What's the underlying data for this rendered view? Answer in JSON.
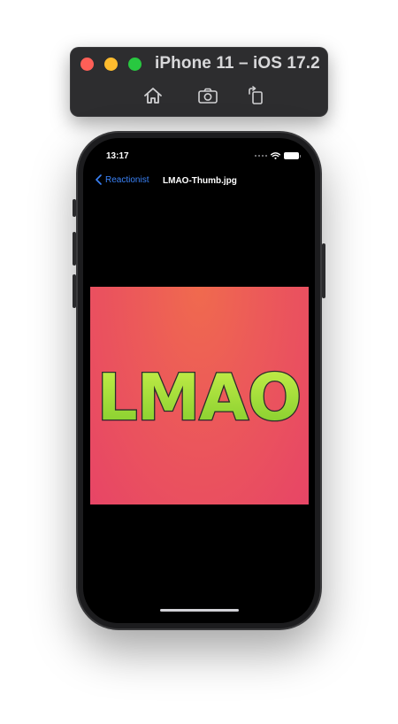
{
  "simulator": {
    "title": "iPhone 11 – iOS 17.2",
    "toolbar": [
      {
        "icon": "home-icon"
      },
      {
        "icon": "screenshot-icon"
      },
      {
        "icon": "rotate-icon"
      }
    ]
  },
  "status_bar": {
    "time": "13:17",
    "icons": [
      "signal-dots-icon",
      "wifi-icon",
      "battery-icon"
    ]
  },
  "nav": {
    "back_label": "Reactionist",
    "title": "LMAO-Thumb.jpg",
    "accent_color": "#3a82f7"
  },
  "image": {
    "text": "LMAO",
    "background_colors": [
      "#f06a4e",
      "#e74566"
    ],
    "text_color": "#a6df3b"
  }
}
